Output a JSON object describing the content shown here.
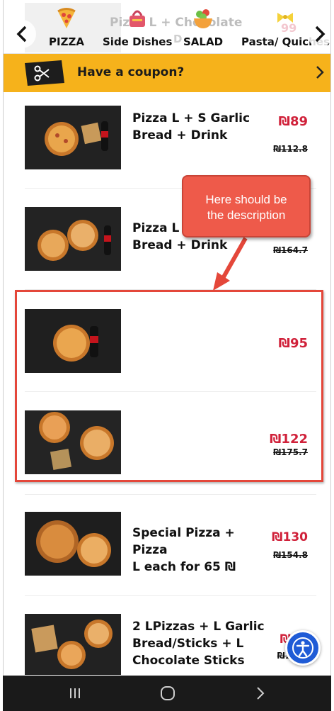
{
  "category_bar": {
    "ghost_title": "Pizza L + Chocolate",
    "ghost_sub": "D",
    "ghost_price": "99",
    "items": [
      {
        "label": "PIZZA",
        "icon": "pizza-icon"
      },
      {
        "label": "Side Dishes",
        "icon": "basket-icon"
      },
      {
        "label": "SALAD",
        "icon": "salad-bowl-icon"
      },
      {
        "label": "Pasta/ Quiches",
        "icon": "pasta-icon"
      }
    ]
  },
  "coupon": {
    "text": "Have a coupon?",
    "icon": "scissors-ticket-icon"
  },
  "annotation": {
    "callout_line1": "Here should be",
    "callout_line2": "the description"
  },
  "products": [
    {
      "title_lines": [
        "Pizza L + S Garlic",
        "Bread + Drink"
      ],
      "price": "₪89",
      "old_price": "₪112.8"
    },
    {
      "title_lines": [
        "Pizza L",
        "Bread + Drink"
      ],
      "price": "",
      "old_price": "₪164.7"
    },
    {
      "title_lines": [
        "",
        ""
      ],
      "price": "₪95",
      "old_price": ""
    },
    {
      "title_lines": [
        "",
        ""
      ],
      "price": "₪122",
      "old_price": "₪175.7"
    },
    {
      "title_lines": [
        "Special Pizza + Pizza",
        "L each for 65 ₪"
      ],
      "price": "₪130",
      "old_price": "₪154.8"
    },
    {
      "title_lines": [
        "2 LPizzas + L Garlic",
        "Bread/Sticks + L",
        "Chocolate Sticks"
      ],
      "price": "₪",
      "old_price": "₪1"
    }
  ],
  "colors": {
    "accent": "#f6b21b",
    "price": "#d0213a",
    "annotation": "#ee5a4a",
    "access": "#1f5bd6"
  }
}
